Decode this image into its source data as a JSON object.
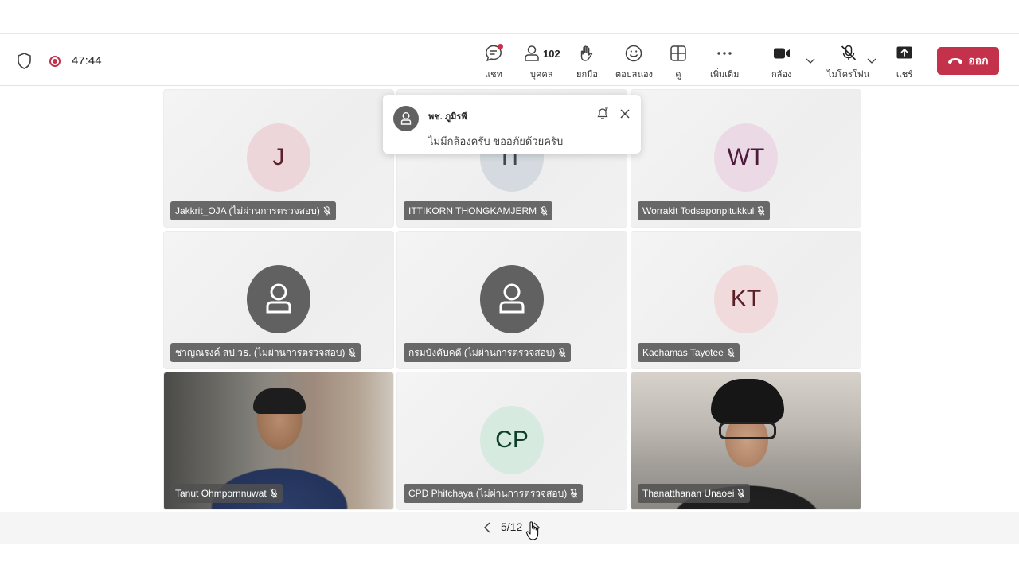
{
  "toolbar": {
    "timer": "47:44",
    "items": [
      {
        "label": "แชท",
        "icon": "chat-icon"
      },
      {
        "label": "บุคคล",
        "icon": "people-icon",
        "count": "102"
      },
      {
        "label": "ยกมือ",
        "icon": "raise-hand-icon"
      },
      {
        "label": "ตอบสนอง",
        "icon": "react-icon"
      },
      {
        "label": "ดู",
        "icon": "view-icon"
      },
      {
        "label": "เพิ่มเติม",
        "icon": "more-icon"
      },
      {
        "label": "กล้อง",
        "icon": "camera-icon"
      },
      {
        "label": "ไมโครโฟน",
        "icon": "mic-off-icon"
      },
      {
        "label": "แชร์",
        "icon": "share-icon"
      }
    ],
    "leave_label": "ออก"
  },
  "toast": {
    "sender": "พช. ภูมิรพี",
    "message": "ไม่มีกล้องครับ ขออภัยด้วยครับ"
  },
  "participants": [
    {
      "name": "Jakkrit_OJA (ไม่ผ่านการตรวจสอบ)",
      "initials": "J",
      "avatar_bg": "#ecd6d9",
      "avatar_fg": "#5c1f2a"
    },
    {
      "name": "ITTIKORN THONGKAMJERM",
      "initials": "IT",
      "avatar_bg": "#d4dadf",
      "avatar_fg": "#3d4a55"
    },
    {
      "name": "Worrakit Todsaponpitukkul",
      "initials": "WT",
      "avatar_bg": "#ecd9e6",
      "avatar_fg": "#4a1c3a"
    },
    {
      "name": "ชาญณรงค์ สป.วธ. (ไม่ผ่านการตรวจสอบ)",
      "initials": "",
      "avatar_bg": "#616161"
    },
    {
      "name": "กรมบังคับคดี (ไม่ผ่านการตรวจสอบ)",
      "initials": "",
      "avatar_bg": "#616161"
    },
    {
      "name": "Kachamas Tayotee",
      "initials": "KT",
      "avatar_bg": "#f0dadb",
      "avatar_fg": "#5c1f2a"
    },
    {
      "name": "Tanut Ohmpornnuwat",
      "initials": "",
      "video": true
    },
    {
      "name": "CPD Phitchaya (ไม่ผ่านการตรวจสอบ)",
      "initials": "CP",
      "avatar_bg": "#d6eadf",
      "avatar_fg": "#0d3f28"
    },
    {
      "name": "Thanatthanan Unaoei",
      "initials": "",
      "video": true
    }
  ],
  "pager": {
    "text": "5/12"
  },
  "colors": {
    "leave": "#c4314b",
    "recording": "#c4314b"
  }
}
